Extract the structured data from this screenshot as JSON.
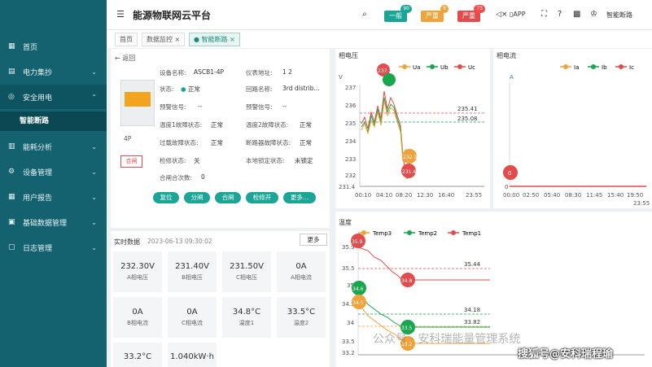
{
  "app": {
    "title": "能源物联网云平台",
    "menu_toggle": "☰"
  },
  "header": {
    "badges": [
      {
        "label": "一般",
        "count": "90",
        "color": "#1aa596"
      },
      {
        "label": "严重",
        "count": "9",
        "color": "#f0a33a"
      },
      {
        "label": "严重",
        "count": "73",
        "color": "#e34c4c"
      }
    ],
    "app_label": "APP",
    "user": "智能断路"
  },
  "sidebar": {
    "items": [
      {
        "label": "首页"
      },
      {
        "label": "电力集抄"
      },
      {
        "label": "安全用电"
      },
      {
        "label": "能耗分析"
      },
      {
        "label": "设备管理"
      },
      {
        "label": "用户报告"
      },
      {
        "label": "基础数据管理"
      },
      {
        "label": "日志管理"
      }
    ],
    "sub_item": "智能断路"
  },
  "tabs": [
    {
      "label": "首页"
    },
    {
      "label": "数据监控"
    },
    {
      "label": "智能断路"
    }
  ],
  "device": {
    "back": "返回",
    "model_label": "设备名称:",
    "model": "ASCB1-4P",
    "address_label": "仪表地址:",
    "address": "1 2",
    "status_label": "状态:",
    "status": "正常",
    "circuit_label": "回路名称:",
    "circuit": "3rd distrib...",
    "pole_label": "4P",
    "open_status": "合闸",
    "rows": [
      {
        "l1": "预警信号:",
        "v1": "--",
        "l2": "预警信号:",
        "v2": "--"
      },
      {
        "l1": "温度1故障状态:",
        "v1": "正常",
        "l2": "温度2故障状态:",
        "v2": "正常"
      },
      {
        "l1": "过载故障状态:",
        "v1": "正常",
        "l2": "断路器故障状态:",
        "v2": "正常"
      },
      {
        "l1": "检修状态:",
        "v1": "关",
        "l2": "本地锁定状态:",
        "v2": "未锁定"
      },
      {
        "l1": "合闸合次数:",
        "v1": "0",
        "l2": "",
        "v2": ""
      }
    ],
    "buttons": [
      "复位",
      "分闸",
      "合闸",
      "检修开",
      "更多..."
    ]
  },
  "realtime": {
    "title": "实时数据",
    "time": "2023-06-13 09:30:02",
    "more": "更多",
    "cards": [
      {
        "value": "232.30V",
        "label": "A相电压"
      },
      {
        "value": "231.40V",
        "label": "B相电压"
      },
      {
        "value": "231.50V",
        "label": "C相电压"
      },
      {
        "value": "0A",
        "label": "A相电流"
      },
      {
        "value": "0A",
        "label": "B相电流"
      },
      {
        "value": "0A",
        "label": "C相电流"
      },
      {
        "value": "34.8°C",
        "label": "温度1"
      },
      {
        "value": "33.5°C",
        "label": "温度2"
      },
      {
        "value": "33.2°C",
        "label": ""
      },
      {
        "value": "1.040kW·h",
        "label": ""
      }
    ]
  },
  "chart_data": [
    {
      "type": "line",
      "title": "相电压",
      "ylabel": "V",
      "series": [
        {
          "name": "Ua",
          "color": "#f0a33a"
        },
        {
          "name": "Ub",
          "color": "#1aa54f"
        },
        {
          "name": "Uc",
          "color": "#e34c4c"
        }
      ],
      "x_ticks": [
        "00:10",
        "04:10",
        "08:20",
        "12:30",
        "16:40",
        "23:55"
      ],
      "y_ticks": [
        "231.4",
        "232",
        "233",
        "234",
        "235",
        "236",
        "237"
      ],
      "ylim": [
        231.4,
        237.5
      ],
      "markers": [
        {
          "text": "237.1",
          "color": "#e34c4c"
        },
        {
          "text": "232.3",
          "color": "#f0a33a"
        },
        {
          "text": "231.4",
          "color": "#e34c4c"
        }
      ],
      "ref_lines": [
        {
          "label": "235.41",
          "color": "#e34c4c"
        },
        {
          "label": "235.08",
          "color": "#1aa54f"
        }
      ]
    },
    {
      "type": "line",
      "title": "相电流",
      "ylabel": "A",
      "series": [
        {
          "name": "Ia",
          "color": "#f0a33a"
        },
        {
          "name": "Ib",
          "color": "#1aa54f"
        },
        {
          "name": "Ic",
          "color": "#e34c4c"
        }
      ],
      "x_ticks": [
        "00:00",
        "02:50",
        "05:40",
        "08:30",
        "11:45",
        "15:40",
        "19:50",
        "23:55"
      ],
      "y_ticks": [
        "0"
      ],
      "markers": [
        {
          "text": "0",
          "color": "#e34c4c"
        }
      ]
    },
    {
      "type": "line",
      "title": "温度",
      "series": [
        {
          "name": "Temp3",
          "color": "#f0a33a"
        },
        {
          "name": "Temp2",
          "color": "#1aa54f"
        },
        {
          "name": "Temp1",
          "color": "#e34c4c"
        }
      ],
      "y_ticks": [
        "33.2",
        "33.5",
        "34",
        "34.5",
        "35",
        "35.5",
        "35.9"
      ],
      "ylim": [
        33.2,
        36.0
      ],
      "markers": [
        {
          "text": "35.9",
          "color": "#e34c4c"
        },
        {
          "text": "34.8",
          "color": "#e34c4c"
        },
        {
          "text": "34.6",
          "color": "#1aa54f"
        },
        {
          "text": "34.5",
          "color": "#f0a33a"
        },
        {
          "text": "33.5",
          "color": "#1aa54f"
        },
        {
          "text": "33.2",
          "color": "#f0a33a"
        }
      ],
      "ref_lines": [
        {
          "label": "35.44",
          "color": "#e34c4c"
        },
        {
          "label": "34.18",
          "color": "#1aa54f"
        },
        {
          "label": "33.82",
          "color": "#f0a33a"
        }
      ]
    }
  ],
  "watermark": "公众号 · 安科瑞能量管理系统",
  "watermark2": "搜狐号@安科瑞程瑜"
}
